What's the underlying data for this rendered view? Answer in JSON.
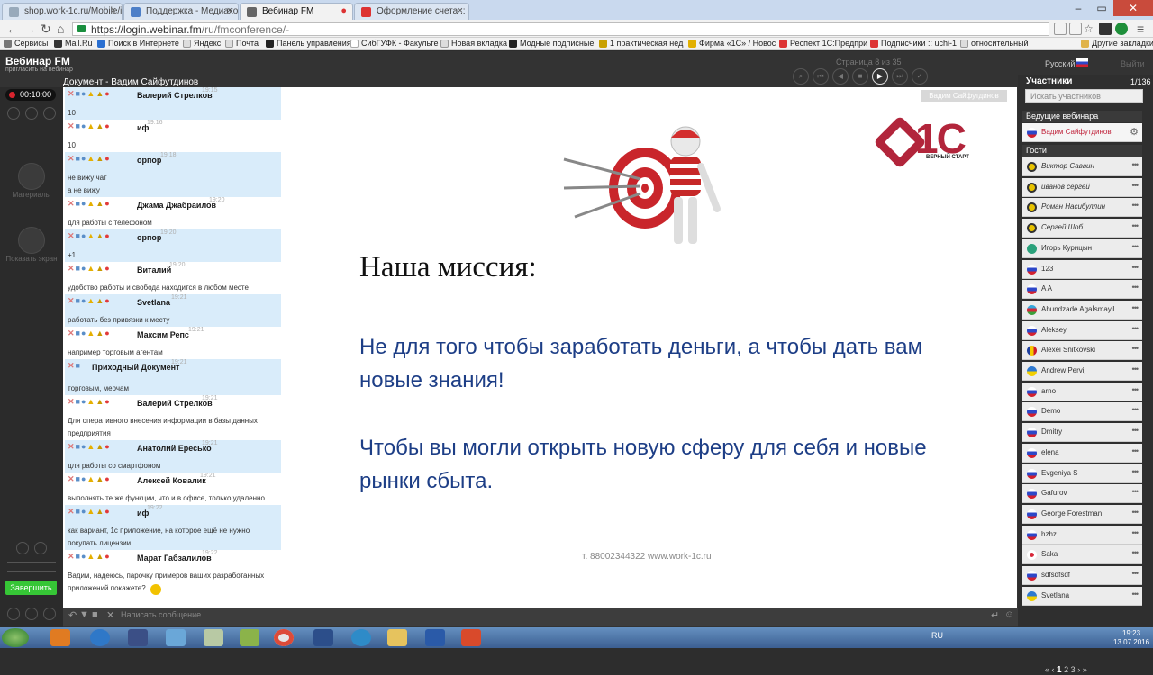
{
  "browser": {
    "tabs": [
      {
        "title": "shop.work-1c.ru/Mobile/i",
        "active": false
      },
      {
        "title": "Поддержка - Медиахол",
        "active": false
      },
      {
        "title": "Вебинар FM",
        "active": true
      },
      {
        "title": "Оформление счета :: Вeр",
        "active": false
      }
    ],
    "url_host": "https://login.webinar.fm",
    "url_path": "/ru/fmconference/-",
    "bookmarks": [
      "Сервисы",
      "Mail.Ru",
      "Поиск в Интернете",
      "Яндекс",
      "Почта",
      "Панель управления",
      "СибГУФК - Факульте",
      "Новая вкладка",
      "Модные подписные",
      "1 практическая нед",
      "Фирма «1С» / Новос",
      "Респект 1С:Предпри",
      "Подписчики :: uchi-1",
      "относительный"
    ],
    "other_bookmarks": "Другие закладки"
  },
  "app": {
    "brand": "Вебинар FM",
    "brand_sub": "пригласить на вебинар",
    "doc_title": "Документ - Вадим Сайфутдинов",
    "page_counter": "Страница 8 из 35",
    "language": "Русский",
    "exit": "Выйти",
    "timer": "00:10:00",
    "rail_materials": "Материалы",
    "rail_screen": "Показать экран",
    "finish": "Завершить"
  },
  "chat": {
    "messages": [
      {
        "author": "Валерий Стрелков",
        "time": "19:15",
        "text": "10"
      },
      {
        "author": "иф",
        "time": "19:16",
        "text": "10"
      },
      {
        "author": "орпор",
        "time": "19:18",
        "text": "не вижу чат\nа не вижу"
      },
      {
        "author": "Джама Джабраилов",
        "time": "19:20",
        "text": "для работы с телефоном"
      },
      {
        "author": "орпор",
        "time": "19:20",
        "text": "+1"
      },
      {
        "author": "Виталий",
        "time": "19:20",
        "text": "удобство работы и свобода находится в любом месте"
      },
      {
        "author": "Svetlana",
        "time": "19:21",
        "text": "работать без привязки к месту"
      },
      {
        "author": "Максим Репс",
        "time": "19:21",
        "text": "например торговым агентам"
      },
      {
        "author": "Приходный Документ",
        "time": "19:21",
        "text": "торговым, мерчам"
      },
      {
        "author": "Валерий Стрелков",
        "time": "19:21",
        "text": "Для оперативного внесения информации в базы данных предприятия"
      },
      {
        "author": "Анатолий Ересько",
        "time": "19:21",
        "text": "для работы со смартфоном"
      },
      {
        "author": "Алексей Ковалик",
        "time": "19:21",
        "text": "выполнять те же функции, что и в офисе, только удаленно"
      },
      {
        "author": "иф",
        "time": "19:22",
        "text": "как вариант, 1с приложение, на которое ещё не нужно покупать лицензии"
      },
      {
        "author": "Марат Габзалилов",
        "time": "19:22",
        "text": "Вадим, надеюсь, парочку примеров ваших разработанных приложений покажете?"
      }
    ],
    "input_placeholder": "Написать сообщение"
  },
  "slide": {
    "presenter_tag": "Вадим Сайфутдинов",
    "logo_text": "1С",
    "logo_sub": "ВЕРНЫЙ СТАРТ",
    "heading": "Наша миссия:",
    "para1": "Не для того чтобы заработать деньги, а чтобы дать вам новые знания!",
    "para2": "Чтобы вы могли открыть новую сферу для себя и новые рынки сбыта.",
    "footer": "т. 88002344322 www.work-1c.ru"
  },
  "participants": {
    "title": "Участники",
    "count": "1/136",
    "search_placeholder": "Искать участников",
    "hosts_label": "Ведущие вебинара",
    "host": "Вадим Сайфутдинов",
    "guests_label": "Гости",
    "guests": [
      {
        "name": "Виктор Саввин",
        "flag": "sm",
        "italic": true
      },
      {
        "name": "иванов сергей",
        "flag": "sm",
        "italic": true
      },
      {
        "name": "Роман Насибуллин",
        "flag": "sm",
        "italic": true
      },
      {
        "name": "Сергей Шоб",
        "flag": "sm",
        "italic": true
      },
      {
        "name": "Игорь Курицын",
        "flag": "gl",
        "italic": false
      },
      {
        "name": "123",
        "flag": "ru",
        "italic": false
      },
      {
        "name": "A A",
        "flag": "ru",
        "italic": false
      },
      {
        "name": "Ahundzade Agaİsmayil",
        "flag": "az",
        "italic": false
      },
      {
        "name": "Aleksey",
        "flag": "ru",
        "italic": false
      },
      {
        "name": "Alexei Snitkovski",
        "flag": "ro",
        "italic": false
      },
      {
        "name": "Andrew Pervij",
        "flag": "ua",
        "italic": false
      },
      {
        "name": "arno",
        "flag": "ru",
        "italic": false
      },
      {
        "name": "Demo",
        "flag": "ru",
        "italic": false
      },
      {
        "name": "Dmitry",
        "flag": "ru",
        "italic": false
      },
      {
        "name": "elena",
        "flag": "ru",
        "italic": false
      },
      {
        "name": "Evgeniya S",
        "flag": "ru",
        "italic": false
      },
      {
        "name": "Gafurov",
        "flag": "ru",
        "italic": false
      },
      {
        "name": "George Forestman",
        "flag": "ru",
        "italic": false
      },
      {
        "name": "hzhz",
        "flag": "ru",
        "italic": false
      },
      {
        "name": "Saka",
        "flag": "jp",
        "italic": false
      },
      {
        "name": "sdfsdfsdf",
        "flag": "ru",
        "italic": false
      },
      {
        "name": "Svetlana",
        "flag": "ua",
        "italic": false
      }
    ],
    "pager": [
      "«",
      "‹",
      "1",
      "2",
      "3",
      "›",
      "»"
    ]
  },
  "taskbar": {
    "lang": "RU",
    "time": "19:23",
    "date": "13.07.2016"
  }
}
